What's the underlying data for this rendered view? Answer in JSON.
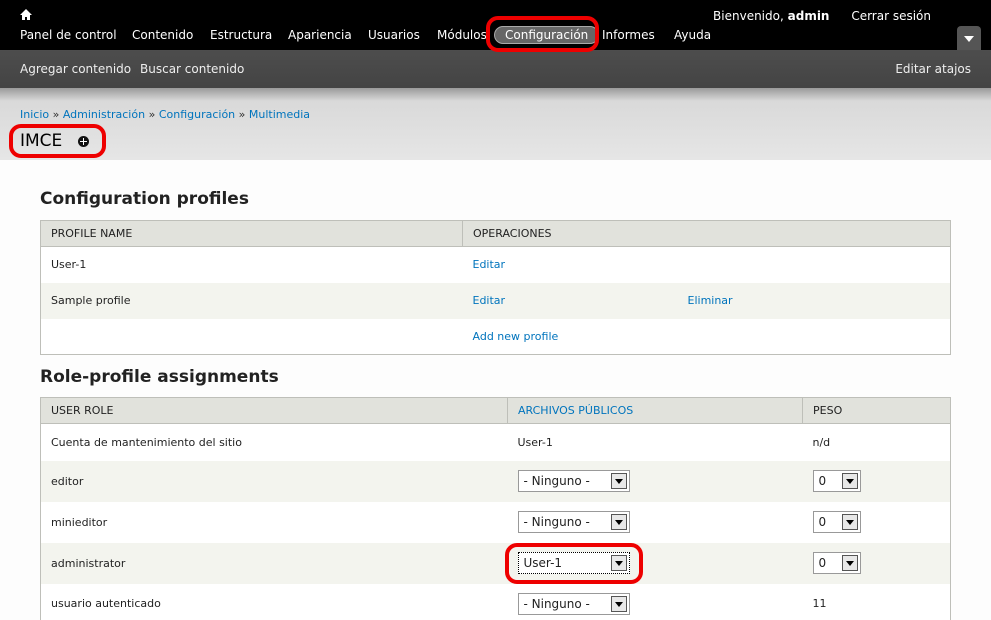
{
  "toolbar": {
    "greeting": "Bienvenido,",
    "username": "admin",
    "logout": "Cerrar sesión",
    "menu": [
      {
        "label": "Panel de control"
      },
      {
        "label": "Contenido"
      },
      {
        "label": "Estructura"
      },
      {
        "label": "Apariencia"
      },
      {
        "label": "Usuarios"
      },
      {
        "label": "Módulos"
      },
      {
        "label": "Configuración"
      },
      {
        "label": "Informes"
      },
      {
        "label": "Ayuda"
      }
    ]
  },
  "shortcuts": {
    "add_content": "Agregar contenido",
    "find_content": "Buscar contenido",
    "edit_shortcuts": "Editar atajos"
  },
  "breadcrumb": [
    "Inicio",
    "Administración",
    "Configuración",
    "Multimedia"
  ],
  "breadcrumb_sep": "»",
  "page_title": "IMCE",
  "profiles": {
    "heading": "Configuration profiles",
    "col_name": "PROFILE NAME",
    "col_ops": "OPERACIONES",
    "rows": [
      {
        "name": "User-1",
        "edit": "Editar",
        "delete": ""
      },
      {
        "name": "Sample profile",
        "edit": "Editar",
        "delete": "Eliminar"
      }
    ],
    "add_new": "Add new profile"
  },
  "roles": {
    "heading": "Role-profile assignments",
    "col_role": "USER ROLE",
    "col_public": "ARCHIVOS PÚBLICOS",
    "col_weight": "PESO",
    "rows": [
      {
        "role": "Cuenta de mantenimiento del sitio",
        "profile": "User-1",
        "weight": "n/d"
      },
      {
        "role": "editor",
        "profile": "- Ninguno -",
        "weight": "0"
      },
      {
        "role": "minieditor",
        "profile": "- Ninguno -",
        "weight": "0"
      },
      {
        "role": "administrator",
        "profile": "User-1",
        "weight": "0"
      },
      {
        "role": "usuario autenticado",
        "profile": "- Ninguno -",
        "weight": "11"
      }
    ]
  }
}
